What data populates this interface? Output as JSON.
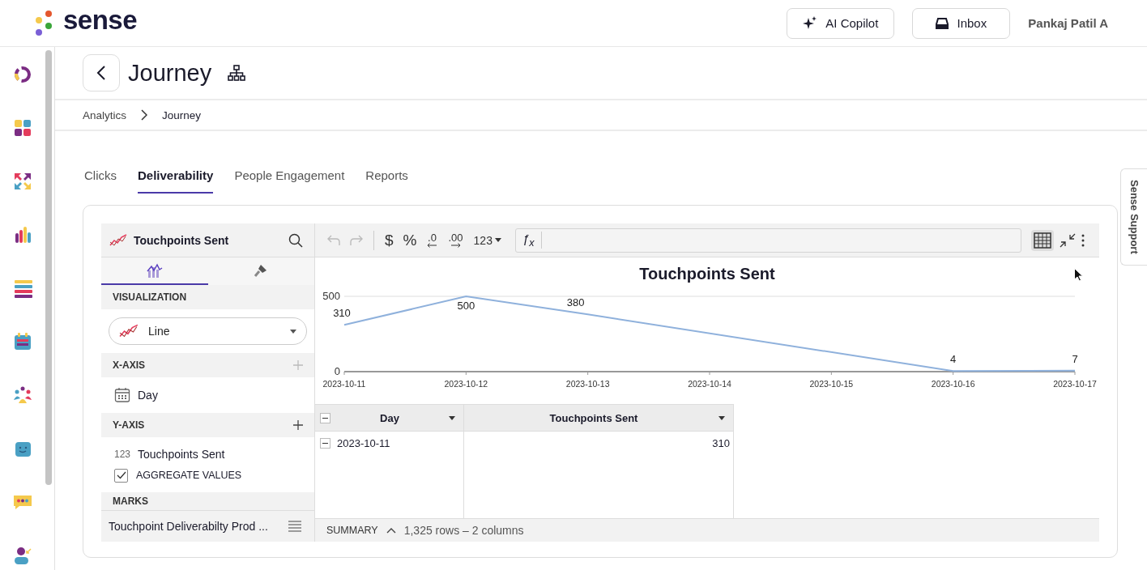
{
  "header": {
    "logo": "sense",
    "buttons": [
      {
        "kind": "copilot",
        "label": "AI Copilot"
      },
      {
        "kind": "inbox",
        "label": "Inbox"
      }
    ],
    "user": "Pankaj Patil A"
  },
  "page": {
    "title": "Journey"
  },
  "breadcrumb": [
    "Analytics",
    "Journey"
  ],
  "tabs": [
    {
      "label": "Clicks",
      "selected": false
    },
    {
      "label": "Deliverability",
      "selected": true
    },
    {
      "label": "People Engagement",
      "selected": false
    },
    {
      "label": "Reports",
      "selected": false
    }
  ],
  "editor": {
    "title": "Touchpoints Sent",
    "panel_tabs": [
      {
        "kind": "data",
        "selected": true
      },
      {
        "kind": "format",
        "selected": false
      }
    ],
    "visualization": {
      "label": "VISUALIZATION",
      "value": "Line"
    },
    "x_axis": {
      "label": "X-AXIS",
      "fields": [
        {
          "kind": "date",
          "name": "Day"
        }
      ]
    },
    "y_axis": {
      "label": "Y-AXIS",
      "fields": [
        {
          "kind": "number",
          "type": "123",
          "name": "Touchpoints Sent"
        }
      ],
      "aggregate": {
        "label": "AGGREGATE VALUES",
        "checked": true
      }
    },
    "marks": {
      "label": "MARKS"
    },
    "source": "Touchpoint Deliverabilty Prod ..."
  },
  "toolbar": {
    "buttons": [
      {
        "kind": "undo",
        "disabled": true
      },
      {
        "kind": "redo",
        "disabled": true
      },
      {
        "kind": "text",
        "label": "$",
        "disabled": false
      },
      {
        "kind": "text",
        "label": "%",
        "disabled": false
      },
      {
        "kind": "decimal-less",
        "label": ".0",
        "disabled": false
      },
      {
        "kind": "decimal-more",
        "label": ".00",
        "disabled": false
      },
      {
        "kind": "menu",
        "label": "123",
        "disabled": false
      }
    ],
    "formula_prefix": "ƒ$_{x}$",
    "table_view": {
      "selected": true
    }
  },
  "chart": {
    "chart_data": {
      "type": "line",
      "title": "Touchpoints Sent",
      "categories": [
        "2023-10-11",
        "2023-10-12",
        "2023-10-13",
        "2023-10-14",
        "2023-10-15",
        "2023-10-16",
        "2023-10-17"
      ],
      "series": [
        {
          "color": "#8fb1dc",
          "values": [
            310,
            500,
            380,
            null,
            null,
            4,
            7
          ]
        }
      ],
      "ylim": [
        0,
        500
      ],
      "yticks": [
        0,
        500
      ],
      "data_labels": true
    }
  },
  "table": {
    "columns": [
      "Day",
      "Touchpoints Sent"
    ],
    "rows": [
      [
        "2023-10-11",
        "310"
      ]
    ]
  },
  "summary": {
    "label": "SUMMARY",
    "text": "1,325 rows – 2 columns"
  },
  "support_tab": "Sense Support"
}
